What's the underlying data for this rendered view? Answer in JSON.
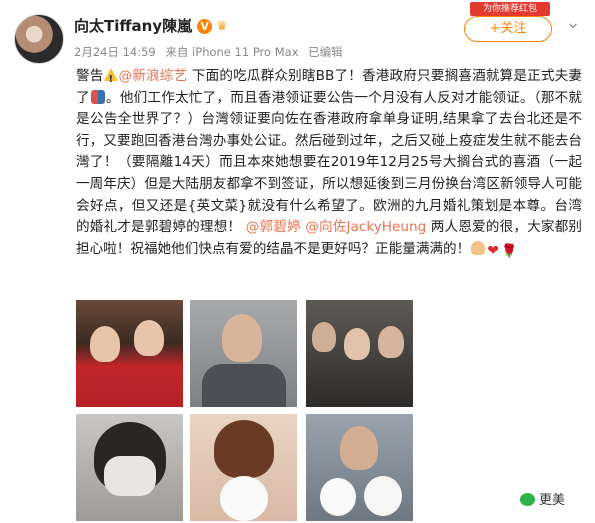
{
  "post": {
    "author": "向太Tiffany陳嵐",
    "verified_badge": "V",
    "date": "2月24日 14:59",
    "source": "来自 iPhone 11 Pro Max",
    "edited": "已编辑",
    "follow_label": "+关注",
    "promo_label": "为你推荐红包",
    "more_icon": "chevron-down-icon",
    "body": {
      "p1": "警告",
      "m1": "@新浪综艺",
      "p2": " 下面的吃瓜群众别瞎BB了！香港政府只要搁喜酒就算是正式夫妻了",
      "p3": "。他们工作太忙了，而且香港领证要公告一个月没有人反对才能领证。（那不就是公告全世界了？）台灣领证要向佐在香港政府拿单身证明,结果拿了去台北还是不行，又要跑回香港台灣办事处公证。然后碰到过年，之后又碰上疫症发生就不能去台灣了！（要隔離14天）而且本來她想要在2019年12月25号大搁台式的喜酒（一起一周年庆）但是大陆朋友都拿不到签证，所以想延後到三月份换台湾区新领导人可能会好点，但又还是{英文菜}就没有什么希望了。欧洲的九月婚礼策划是本尊。台湾的婚礼才是郭碧婷的理想！",
      "m2": "@郭碧婷",
      "m3": "@向佐JackyHeung",
      "p4": " 两人恩爱的很，大家都别担心啦！祝福她他们快点有爱的结晶不是更好吗？正能量满满的！"
    },
    "photos": [
      {
        "name": "couple-red-sweaters"
      },
      {
        "name": "man-gesturing"
      },
      {
        "name": "three-friends"
      },
      {
        "name": "masked-woman"
      },
      {
        "name": "woman-with-dog"
      },
      {
        "name": "man-with-dogs"
      }
    ],
    "watermark": "更美"
  },
  "colors": {
    "accent": "#ff8200",
    "link": "#eb7350",
    "meta": "#888888"
  }
}
